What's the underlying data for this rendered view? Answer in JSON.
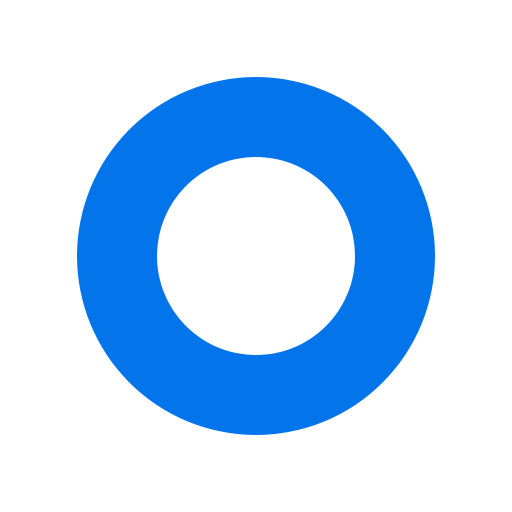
{
  "icon": {
    "name": "ring-logo-icon",
    "color": "#0474EB",
    "background": "#FFFFFF"
  }
}
